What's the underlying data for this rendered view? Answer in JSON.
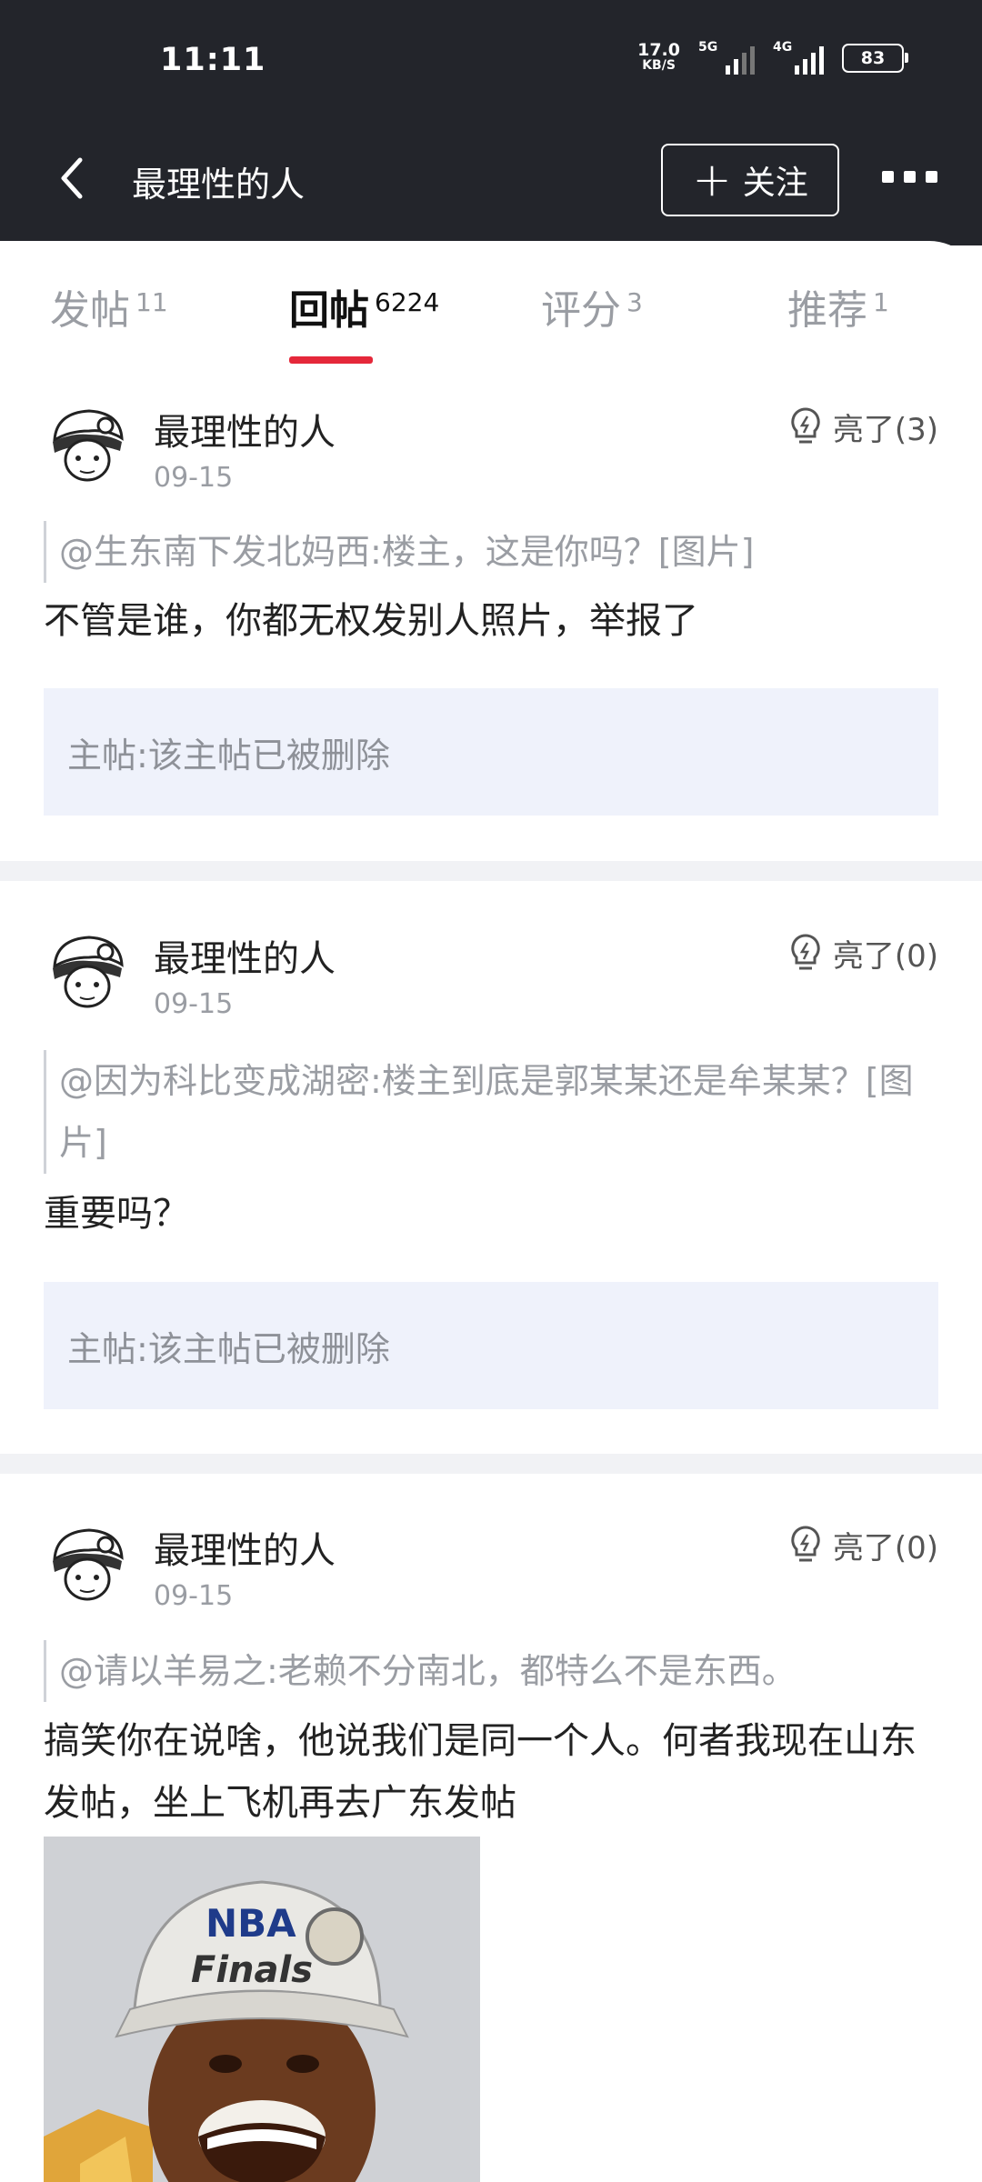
{
  "status_bar": {
    "time": "11:11",
    "net_speed": "17.0",
    "net_unit": "KB/S",
    "sig1_label": "5G",
    "sig2_label": "4G",
    "battery": "83"
  },
  "header": {
    "title": "最理性的人",
    "follow_label": "关注",
    "follow_plus": "+"
  },
  "tabs": [
    {
      "label": "发帖",
      "count": "11"
    },
    {
      "label": "回帖",
      "count": "6224"
    },
    {
      "label": "评分",
      "count": "3"
    },
    {
      "label": "推荐",
      "count": "1"
    }
  ],
  "posts": [
    {
      "username": "最理性的人",
      "date": "09-15",
      "light": "亮了(3)",
      "quote": "@生东南下发北妈西:楼主，这是你吗？[图片]",
      "reply": "不管是谁，你都无权发别人照片，举报了",
      "main_label": "主帖:",
      "main_text": " 该主帖已被删除"
    },
    {
      "username": "最理性的人",
      "date": "09-15",
      "light": "亮了(0)",
      "quote": "@因为科比变成湖密:楼主到底是郭某某还是牟某某？[图片]",
      "reply": "重要吗？",
      "main_label": "主帖:",
      "main_text": " 该主帖已被删除"
    },
    {
      "username": "最理性的人",
      "date": "09-15",
      "light": "亮了(0)",
      "quote": "@请以羊易之:老赖不分南北，都特么不是东西。",
      "reply": "搞笑你在说啥，他说我们是同一个人。何者我现在山东发帖，坐上飞机再去广东发帖",
      "image_text": "NBA Finals"
    }
  ],
  "colors": {
    "header_bg": "#23252b",
    "accent_red": "#e5283a",
    "mainpost_bg": "#eff2fb"
  }
}
